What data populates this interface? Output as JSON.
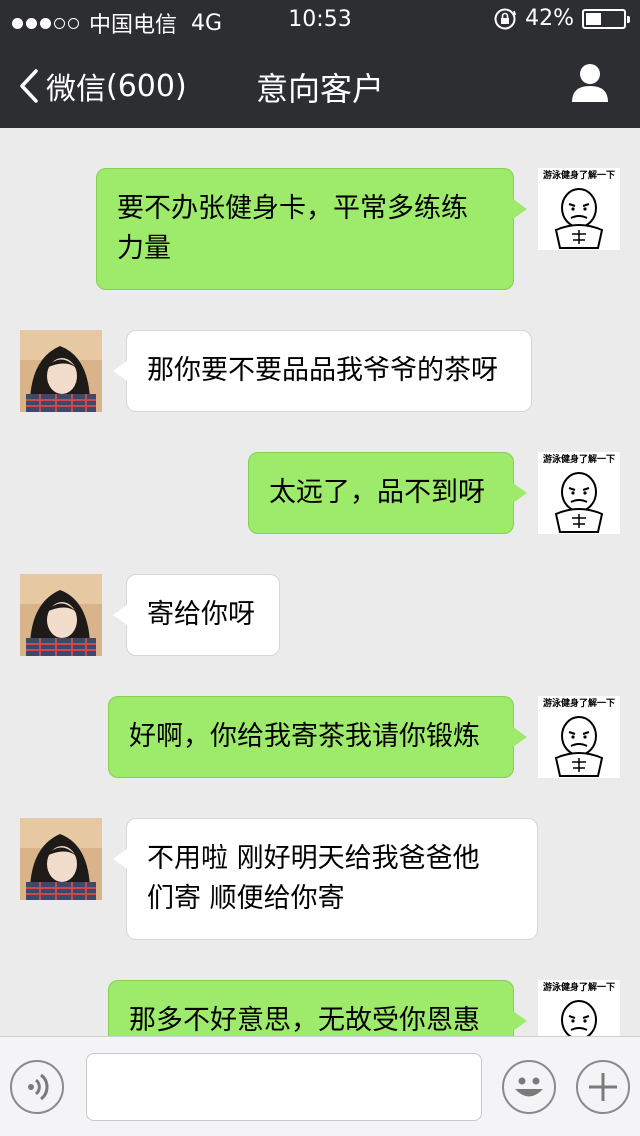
{
  "status_bar": {
    "carrier": "中国电信",
    "network": "4G",
    "time": "10:53",
    "battery": "42%",
    "battery_level": 0.42
  },
  "nav": {
    "back_label": "微信",
    "unread": "(600)",
    "title": "意向客户"
  },
  "sticker_caption": "游泳健身了解一下",
  "messages": [
    {
      "side": "sent",
      "lines": [
        "要不办张健身卡，平常多练练",
        "力量"
      ]
    },
    {
      "side": "recv",
      "lines": [
        "那你要不要品品我爷爷的茶呀"
      ]
    },
    {
      "side": "sent",
      "lines": [
        "太远了，品不到呀"
      ]
    },
    {
      "side": "recv",
      "lines": [
        "寄给你呀"
      ]
    },
    {
      "side": "sent",
      "lines": [
        "好啊，你给我寄茶我请你锻炼"
      ]
    },
    {
      "side": "recv",
      "lines": [
        "不用啦 刚好明天给我爸爸他",
        "们寄 顺便给你寄"
      ]
    },
    {
      "side": "sent",
      "lines": [
        "那多不好意思，无故受你恩惠"
      ]
    }
  ],
  "input": {
    "value": ""
  },
  "colors": {
    "header_bg": "#2d2e32",
    "sent_bubble": "#9eea6a",
    "recv_bubble": "#ffffff",
    "chat_bg": "#ebebeb"
  }
}
